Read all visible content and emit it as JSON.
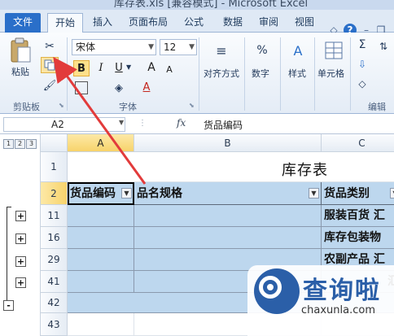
{
  "window": {
    "title": "库存表.xls  [兼容模式]  -  Microsoft Excel"
  },
  "ribbon_tabs": [
    {
      "label": "文件"
    },
    {
      "label": "开始"
    },
    {
      "label": "插入"
    },
    {
      "label": "页面布局"
    },
    {
      "label": "公式"
    },
    {
      "label": "数据"
    },
    {
      "label": "审阅"
    },
    {
      "label": "视图"
    }
  ],
  "ribbon": {
    "clipboard": {
      "paste_label": "粘贴",
      "group_label": "剪贴板"
    },
    "font": {
      "font_name": "宋体",
      "font_size": "12",
      "bold": "B",
      "italic": "I",
      "underline": "U",
      "grow": "A",
      "shrink": "A",
      "font_color": "A",
      "group_label": "字体"
    },
    "align": {
      "label": "对齐方式"
    },
    "number": {
      "label": "数字",
      "symbol": "%"
    },
    "styles": {
      "label": "样式"
    },
    "cells": {
      "label": "单元格"
    },
    "editing": {
      "label": "编辑",
      "sum_symbol": "Σ"
    }
  },
  "formula_bar": {
    "name_box": "A2",
    "fx": "fx",
    "formula": "货品编码"
  },
  "outline": {
    "levels": [
      "1",
      "2",
      "3"
    ],
    "expand_symbol": "+",
    "collapse_symbol": "-"
  },
  "sheet": {
    "columns": [
      "A",
      "B",
      "C"
    ],
    "title": "库存表",
    "rows": [
      {
        "row": "1",
        "a": "",
        "b": "",
        "c": ""
      },
      {
        "row": "2",
        "a": "货品编码",
        "b": "品名规格",
        "c": "货品类别"
      },
      {
        "row": "11",
        "a": "",
        "b": "",
        "c": "服装百货 汇"
      },
      {
        "row": "16",
        "a": "",
        "b": "",
        "c": "库存包装物"
      },
      {
        "row": "29",
        "a": "",
        "b": "",
        "c": "农副产品 汇"
      },
      {
        "row": "41",
        "a": "",
        "b": "",
        "c": "汇"
      },
      {
        "row": "42",
        "a": "",
        "b": "",
        "c": ""
      },
      {
        "row": "43",
        "a": "",
        "b": "",
        "c": ""
      }
    ]
  },
  "watermark": {
    "text": "查询啦",
    "url": "chaxunla.com"
  },
  "colors": {
    "accent": "#2a6fc9",
    "header_fill": "#bdd7ee",
    "arrow": "#e23b3b",
    "selection": "#f7d36b"
  }
}
